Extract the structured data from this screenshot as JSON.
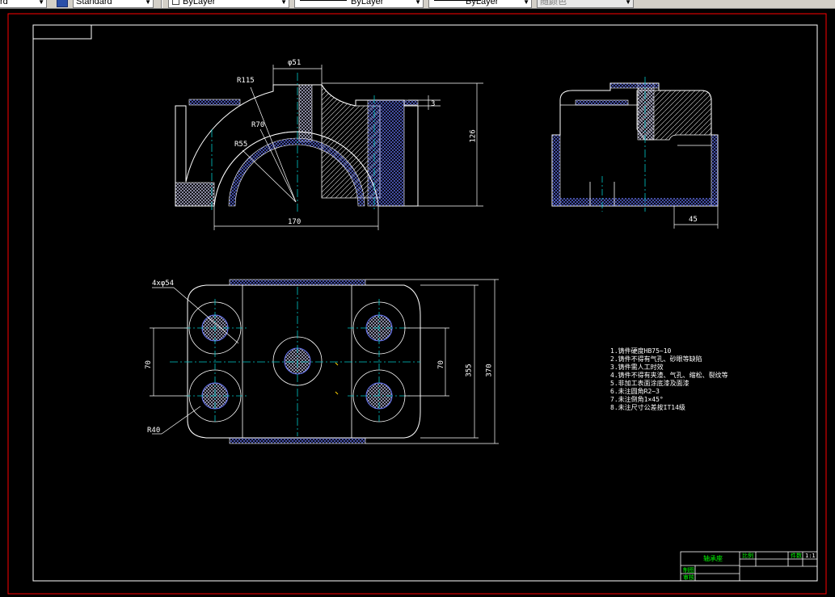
{
  "toolbar": {
    "style_tail": "rd",
    "text_style": "Standard",
    "layer": "ByLayer",
    "linetype": "ByLayer",
    "lineweight": "ByLayer",
    "plot_style": "随颜色"
  },
  "dimensions": {
    "phi51": "φ51",
    "r115": "R115",
    "r70": "R70",
    "r55": "R55",
    "d170_front": "170",
    "d126": "126",
    "d3": "3",
    "d45": "45",
    "phi54": "4xφ54",
    "r40": "R40",
    "d70_left": "70",
    "d70_right": "70",
    "d355": "355",
    "d370": "370"
  },
  "notes": [
    "1.铸件硬度HB75~10",
    "2.铸件不得有气孔、砂眼等缺陷",
    "3.铸件需人工时效",
    "4.铸件不得有夹渣、气孔、缩松、裂纹等",
    "5.非加工表面涂底漆及面漆",
    "6.未注圆角R2~3",
    "7.未注倒角1×45°",
    "8.未注尺寸公差按IT14级"
  ],
  "title_block": {
    "part_name": "轴承座",
    "cell_a": "比例",
    "cell_b": "件数",
    "cell_c": "1:1",
    "cell_d": "制图",
    "cell_e": "审核"
  },
  "colors": {
    "background": "#000000",
    "frame": "#ffffff",
    "outer_border": "#ff0000",
    "center_line": "#00c8c8",
    "hatch": "#6a7aff",
    "text": "#ffffff",
    "title_text": "#00ff00"
  }
}
